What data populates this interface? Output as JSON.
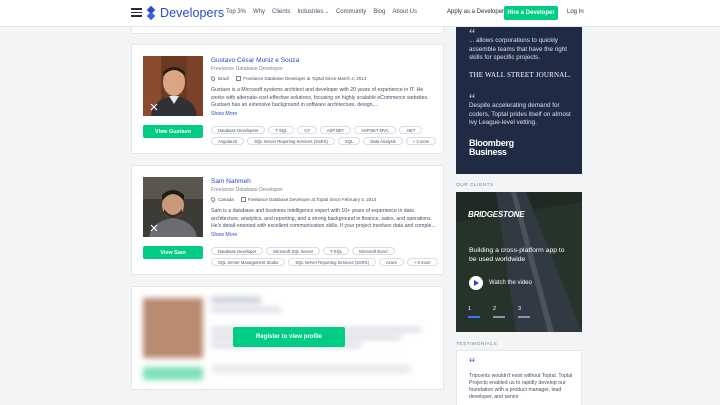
{
  "nav": {
    "logo": "Developers",
    "menu": [
      "Top 3%",
      "Why",
      "Clients",
      "Industries",
      "Community",
      "Blog",
      "About Us"
    ],
    "apply": "Apply as a Developer",
    "hire": "Hire a Developer",
    "login": "Log In"
  },
  "profiles": [
    {
      "name": "Gustavo César Muniz e Souza",
      "role": "Freelance Database Developer",
      "location": "Brazil",
      "since": "Freelance Database Developer at Toptal Since March 4, 2014",
      "bio": "Gustavo is a Microsoft systems architect and developer with 20 years of experience in IT. He works with alternate-cost-effective solutions, focusing on highly scalable eCommerce websites. Gustavo has an extensive background in software architecture, design,...",
      "more": "Show More",
      "button": "View Gustavo",
      "tags": [
        "Database Developers",
        "T-SQL",
        "C#",
        "ASP.NET",
        "ASP.NET MVC",
        ".NET",
        "AngularJS",
        "SQL Server Reporting Services (SSRS)",
        "SQL",
        "Data Analysis",
        "+ 2 more"
      ]
    },
    {
      "name": "Sam Nahmeh",
      "role": "Freelance Database Developer",
      "location": "Canada",
      "since": "Freelance Database Developer at Toptal Since February 5, 2014",
      "bio": "Sam is a database and business intelligence expert with 10+ years of experience in data architecture, analytics, and reporting, and a strong background in finance, sales, and operations. He's detail-oriented with excellent communication skills. If your project involves data and comple...",
      "more": "Show More",
      "button": "View Sam",
      "tags": [
        "Database Developer",
        "Microsoft SQL Server",
        "T-SQL",
        "Microsoft Excel",
        "SQL Server Management Studio",
        "SQL Server Reporting Services (SSRS)",
        "Azure",
        "+ 6 more"
      ]
    }
  ],
  "locked": {
    "button": "Register to view profile"
  },
  "sidebar": {
    "quote1": "... allows corporations to quickly assemble teams that have the right skills for specific projects.",
    "source1": "THE WALL STREET JOURNAL.",
    "quote2": "Despite accelerating demand for coders, Toptal prides itself on almost Ivy League-level vetting.",
    "source2_line1": "Bloomberg",
    "source2_line2": "Business",
    "our_clients": "OUR CLIENTS",
    "client_brand": "BRIDGESTONE",
    "video_title": "Building a cross-platform app to be used worldwide",
    "watch": "Watch the video",
    "slides": [
      "1",
      "2",
      "3"
    ],
    "testimonials": "TESTIMONIALS",
    "testimonial": "Tripcents wouldn't exist without Toptal. Toptal Projects enabled us to rapidly develop our foundation with a product manager, lead developer, and senior"
  }
}
